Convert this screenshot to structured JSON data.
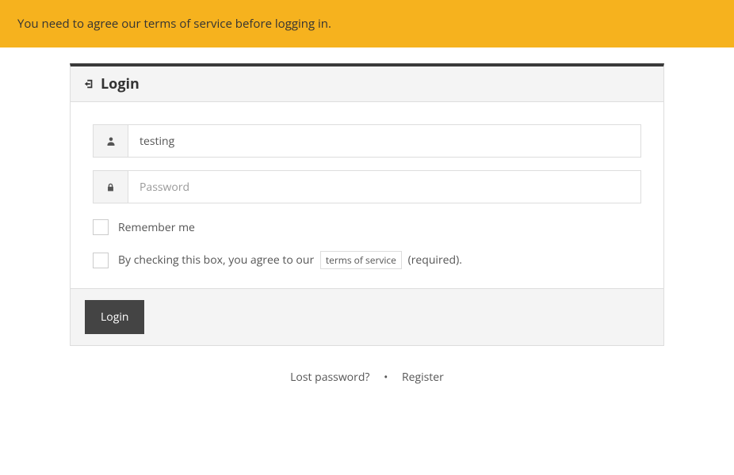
{
  "alert": {
    "message": "You need to agree our terms of service before logging in."
  },
  "panel": {
    "title": "Login"
  },
  "form": {
    "username_value": "testing",
    "password_placeholder": "Password",
    "remember_label": "Remember me",
    "tos_prefix": "By checking this box, you agree to our",
    "tos_link_text": "terms of service",
    "tos_suffix": "(required).",
    "login_button": "Login"
  },
  "footer": {
    "lost_password": "Lost password?",
    "separator": "•",
    "register": "Register"
  }
}
